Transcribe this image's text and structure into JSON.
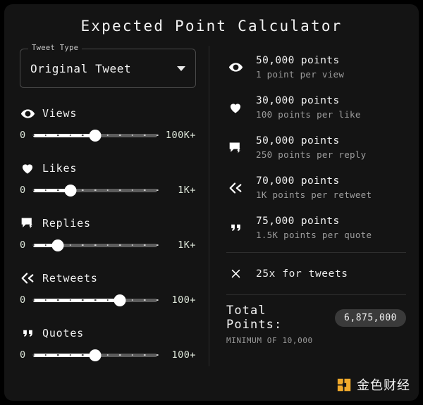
{
  "app": {
    "title": "Expected Point Calculator"
  },
  "tweet_type": {
    "label": "Tweet Type",
    "value": "Original Tweet",
    "caret_icon": "chevron-down-icon"
  },
  "sliders": [
    {
      "key": "views",
      "icon": "eye-icon",
      "label": "Views",
      "min_label": "0",
      "max_label": "100K+",
      "percent": 50,
      "ticks": 11
    },
    {
      "key": "likes",
      "icon": "heart-icon",
      "label": "Likes",
      "min_label": "0",
      "max_label": "1K+",
      "percent": 30,
      "ticks": 11
    },
    {
      "key": "replies",
      "icon": "reply-bubble-icon",
      "label": "Replies",
      "min_label": "0",
      "max_label": "1K+",
      "percent": 20,
      "ticks": 11
    },
    {
      "key": "retweets",
      "icon": "retweet-arrow-icon",
      "label": "Retweets",
      "min_label": "0",
      "max_label": "100+",
      "percent": 70,
      "ticks": 11
    },
    {
      "key": "quotes",
      "icon": "quote-icon",
      "label": "Quotes",
      "min_label": "0",
      "max_label": "100+",
      "percent": 50,
      "ticks": 11
    }
  ],
  "stats": [
    {
      "key": "views",
      "icon": "eye-icon",
      "points": "50,000 points",
      "rate": "1 point per view"
    },
    {
      "key": "likes",
      "icon": "heart-icon",
      "points": "30,000 points",
      "rate": "100 points per like"
    },
    {
      "key": "replies",
      "icon": "reply-bubble-icon",
      "points": "50,000 points",
      "rate": "250 points per reply"
    },
    {
      "key": "retweets",
      "icon": "retweet-arrow-icon",
      "points": "70,000 points",
      "rate": "1K points per retweet"
    },
    {
      "key": "quotes",
      "icon": "quote-icon",
      "points": "75,000 points",
      "rate": "1.5K points per quote"
    }
  ],
  "multiplier": {
    "icon": "multiply-icon",
    "text": "25x for tweets"
  },
  "total": {
    "label": "Total Points:",
    "value": "6,875,000",
    "minimum": "MINIMUM OF 10,000"
  },
  "watermark": {
    "text": "金色财经",
    "icon": "jinse-logo-icon",
    "color": "#f0a92b"
  },
  "colors": {
    "background": "#000000",
    "card": "#141414",
    "accent_white": "#ffffff",
    "rail": "#5c5c5c",
    "muted_text": "#9d9d9d",
    "badge": "#3a3a3a"
  }
}
